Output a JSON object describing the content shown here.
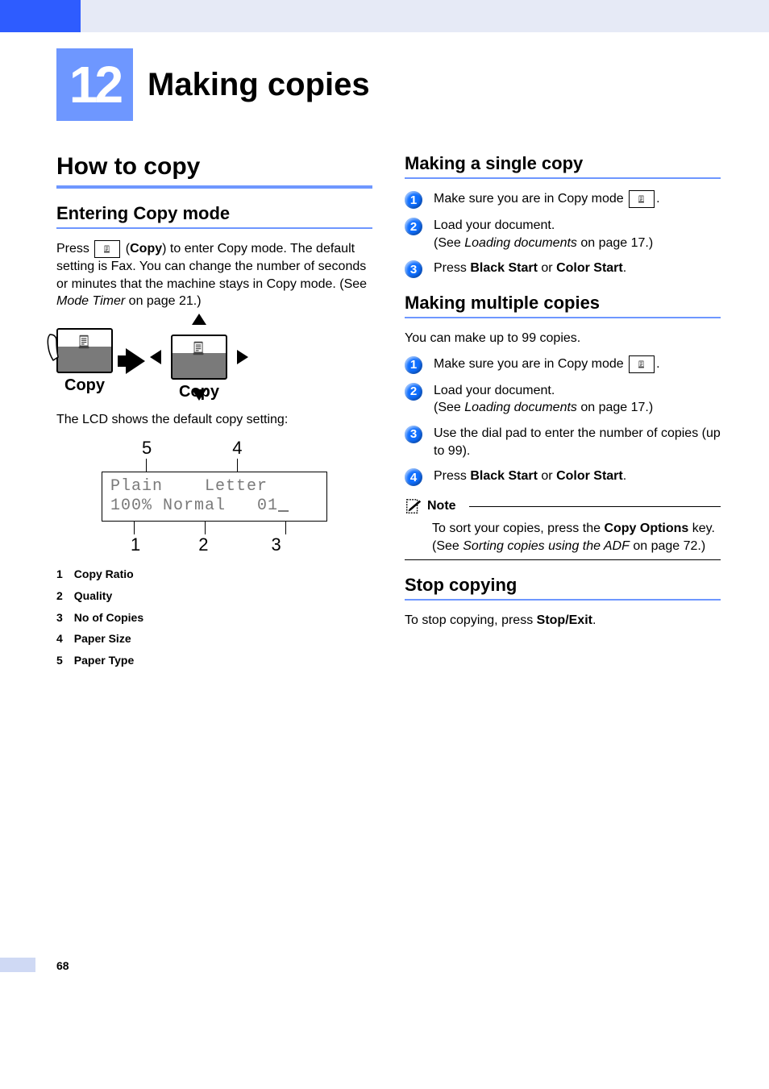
{
  "chapter": {
    "number": "12",
    "title": "Making copies"
  },
  "page_number": "68",
  "left": {
    "h1": "How to copy",
    "h2": "Entering Copy mode",
    "para1_a": "Press ",
    "para1_b": " (",
    "para1_bold": "Copy",
    "para1_c": ") to enter Copy mode. The default setting is Fax. You can change the number of seconds or minutes that the machine stays in Copy mode. (See ",
    "para1_italic": "Mode Timer",
    "para1_d": " on page 21.)",
    "copy_label": "Copy",
    "lcd_intro": "The LCD shows the default copy setting:",
    "lcd": {
      "top_labels": [
        "5",
        "4"
      ],
      "line1": "Plain    Letter",
      "line2": "100% Normal   01",
      "bottom_labels": [
        "1",
        "2",
        "3"
      ]
    },
    "legend": [
      {
        "n": "1",
        "t": "Copy Ratio"
      },
      {
        "n": "2",
        "t": "Quality"
      },
      {
        "n": "3",
        "t": "No of Copies"
      },
      {
        "n": "4",
        "t": "Paper Size"
      },
      {
        "n": "5",
        "t": "Paper Type"
      }
    ]
  },
  "right": {
    "single": {
      "h2": "Making a single copy",
      "steps": [
        {
          "n": "1",
          "a": "Make sure you are in Copy mode ",
          "b": "."
        },
        {
          "n": "2",
          "a": "Load your document.",
          "sub_a": "(See ",
          "sub_i": "Loading documents",
          "sub_b": " on page 17.)"
        },
        {
          "n": "3",
          "a": "Press ",
          "bold1": "Black Start",
          "mid": " or ",
          "bold2": "Color Start",
          "end": "."
        }
      ]
    },
    "multiple": {
      "h2": "Making multiple copies",
      "intro": "You can make up to 99 copies.",
      "steps": [
        {
          "n": "1",
          "a": "Make sure you are in Copy mode ",
          "b": "."
        },
        {
          "n": "2",
          "a": "Load your document.",
          "sub_a": "(See ",
          "sub_i": "Loading documents",
          "sub_b": " on page 17.)"
        },
        {
          "n": "3",
          "a": "Use the dial pad to enter the number of copies (up to 99)."
        },
        {
          "n": "4",
          "a": "Press ",
          "bold1": "Black Start",
          "mid": " or ",
          "bold2": "Color Start",
          "end": "."
        }
      ],
      "note": {
        "label": "Note",
        "a": "To sort your copies, press the ",
        "bold": "Copy Options",
        "b": " key. (See ",
        "italic": "Sorting copies using the ADF",
        "c": " on page 72.)"
      }
    },
    "stop": {
      "h2": "Stop copying",
      "a": "To stop copying, press ",
      "bold": "Stop/Exit",
      "b": "."
    }
  }
}
